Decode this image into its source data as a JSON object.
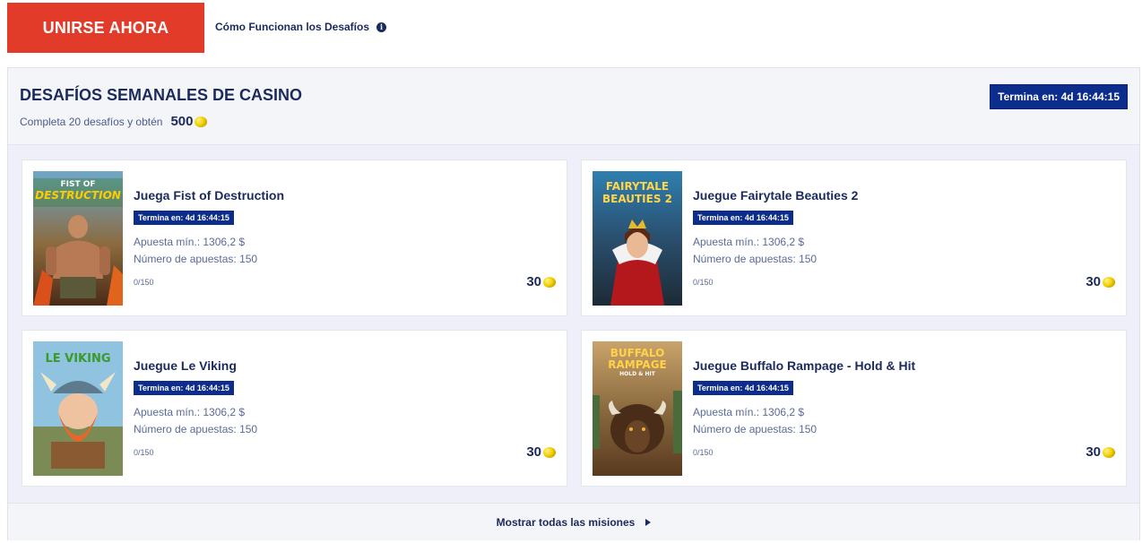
{
  "header": {
    "join_label": "UNIRSE AHORA",
    "how_it_works_label": "Cómo Funcionan los Desafíos",
    "info_icon": "info-icon"
  },
  "panel": {
    "title": "DESAFÍOS SEMANALES DE CASINO",
    "subtitle": "Completa 20 desafíos y obtén",
    "reward": "500",
    "timer": "Termina en: 4d 16:44:15",
    "show_all_label": "Mostrar todas las misiones"
  },
  "cards": [
    {
      "title": "Juega Fist of Destruction",
      "timer": "Termina en: 4d 16:44:15",
      "min_bet": "Apuesta mín.: 1306,2 $",
      "num_bets": "Número de apuestas: 150",
      "progress": "0/150",
      "points": "30",
      "thumb_logo": [
        "FIST OF",
        "DESTRUCTION"
      ]
    },
    {
      "title": "Juegue Fairytale Beauties 2",
      "timer": "Termina en: 4d 16:44:15",
      "min_bet": "Apuesta mín.: 1306,2 $",
      "num_bets": "Número de apuestas: 150",
      "progress": "0/150",
      "points": "30",
      "thumb_logo": [
        "FAIRYTALE",
        "BEAUTIES 2"
      ]
    },
    {
      "title": "Juegue Le Viking",
      "timer": "Termina en: 4d 16:44:15",
      "min_bet": "Apuesta mín.: 1306,2 $",
      "num_bets": "Número de apuestas: 150",
      "progress": "0/150",
      "points": "30",
      "thumb_logo": [
        "LE VIKING"
      ]
    },
    {
      "title": "Juegue Buffalo Rampage - Hold & Hit",
      "timer": "Termina en: 4d 16:44:15",
      "min_bet": "Apuesta mín.: 1306,2 $",
      "num_bets": "Número de apuestas: 150",
      "progress": "0/150",
      "points": "30",
      "thumb_logo": [
        "BUFFALO",
        "RAMPAGE",
        "HOLD & HIT"
      ]
    }
  ],
  "colors": {
    "accent": "#e23b2a",
    "navy": "#1b2a5c",
    "timer_bg": "#0d2d8c",
    "panel_bg": "#eeeff8",
    "coin": "#f2d100"
  }
}
